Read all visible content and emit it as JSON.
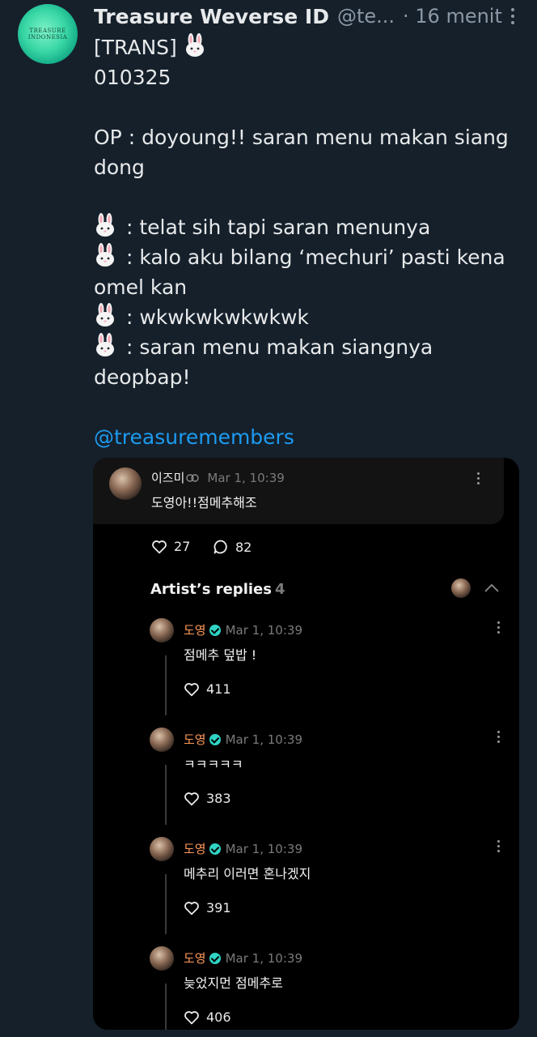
{
  "tweet": {
    "author_name": "Treasure Weverse ID",
    "handle": "@te...",
    "time": "· 16 menit",
    "avatar_logo_text_1": "TREASURE",
    "avatar_logo_text_2": "INDONESIA",
    "lines": [
      "[TRANS] ",
      "010325",
      "",
      "OP : doyoung!! saran menu makan siang",
      "dong",
      "",
      " : telat sih tapi saran menunya",
      " : kalo aku bilang ‘mechuri’ pasti kena",
      "omel kan",
      " : wkwkwkwkwkwk",
      " : saran menu makan siangnya",
      "deopbap!",
      ""
    ],
    "mention": "@treasuremembers"
  },
  "embed": {
    "post": {
      "username": "이즈미",
      "timestamp": "Mar 1, 10:39",
      "text": "도영아!!점메추해조",
      "likes": "27",
      "comments": "82"
    },
    "section_title": "Artist’s replies",
    "section_count": "4",
    "replies": [
      {
        "name": "도영",
        "timestamp": "Mar 1, 10:39",
        "text": "점메추 덮밥 !",
        "likes": "411"
      },
      {
        "name": "도영",
        "timestamp": "Mar 1, 10:39",
        "text": "ㅋㅋㅋㅋㅋ",
        "likes": "383"
      },
      {
        "name": "도영",
        "timestamp": "Mar 1, 10:39",
        "text": "메추리 이러면 혼나겠지",
        "likes": "391"
      },
      {
        "name": "도영",
        "timestamp": "Mar 1, 10:39",
        "text": "늦었지먼 점메추로",
        "likes": "406"
      }
    ]
  },
  "colors": {
    "background": "#15202b",
    "mention": "#1d9bf0",
    "artist_name": "#ff9a5a",
    "verified": "#2fd4c4"
  }
}
